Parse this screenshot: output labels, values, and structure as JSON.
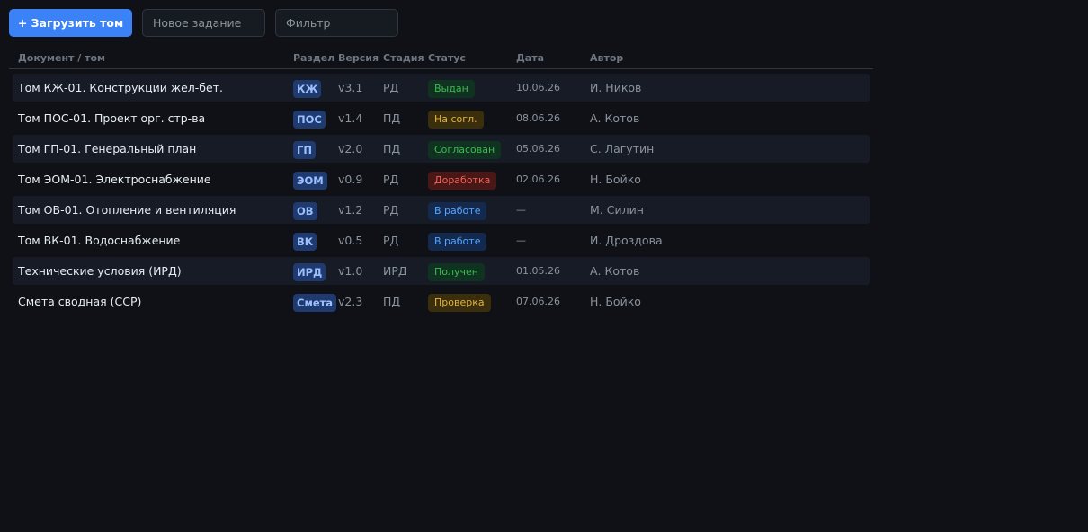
{
  "toolbar": {
    "upload_label": "+ Загрузить том",
    "task_placeholder": "Новое задание",
    "filter_placeholder": "Фильтр"
  },
  "table": {
    "headers": {
      "doc": "Документ / том",
      "section": "Раздел",
      "version": "Версия",
      "stage": "Стадия",
      "status": "Статус",
      "date": "Дата",
      "author": "Автор"
    },
    "rows": [
      {
        "doc": "Том КЖ-01. Конструкции жел-бет.",
        "section": "КЖ",
        "version": "v3.1",
        "stage": "РД",
        "status": "Выдан",
        "status_kind": "green",
        "date": "10.06.26",
        "author": "И. Ников"
      },
      {
        "doc": "Том ПОС-01. Проект орг. стр-ва",
        "section": "ПОС",
        "version": "v1.4",
        "stage": "ПД",
        "status": "На согл.",
        "status_kind": "yellow",
        "date": "08.06.26",
        "author": "А. Котов"
      },
      {
        "doc": "Том ГП-01. Генеральный план",
        "section": "ГП",
        "version": "v2.0",
        "stage": "ПД",
        "status": "Согласован",
        "status_kind": "green",
        "date": "05.06.26",
        "author": "С. Лагутин"
      },
      {
        "doc": "Том ЭОМ-01. Электроснабжение",
        "section": "ЭОМ",
        "version": "v0.9",
        "stage": "РД",
        "status": "Доработка",
        "status_kind": "red",
        "date": "02.06.26",
        "author": "Н. Бойко"
      },
      {
        "doc": "Том ОВ-01. Отопление и вентиляция",
        "section": "ОВ",
        "version": "v1.2",
        "stage": "РД",
        "status": "В работе",
        "status_kind": "blue",
        "date": "—",
        "author": "М. Силин"
      },
      {
        "doc": "Том ВК-01. Водоснабжение",
        "section": "ВК",
        "version": "v0.5",
        "stage": "РД",
        "status": "В работе",
        "status_kind": "blue",
        "date": "—",
        "author": "И. Дроздова"
      },
      {
        "doc": "Технические условия (ИРД)",
        "section": "ИРД",
        "version": "v1.0",
        "stage": "ИРД",
        "status": "Получен",
        "status_kind": "green",
        "date": "01.05.26",
        "author": "А. Котов"
      },
      {
        "doc": "Смета сводная (ССР)",
        "section": "Смета",
        "version": "v2.3",
        "stage": "ПД",
        "status": "Проверка",
        "status_kind": "yellow",
        "date": "07.06.26",
        "author": "Н. Бойко"
      }
    ]
  },
  "status_colors": {
    "green": {
      "bg": "#0f3320",
      "fg": "#3fb950"
    },
    "yellow": {
      "bg": "#3a2e0c",
      "fg": "#e3b341"
    },
    "red": {
      "bg": "#4a1717",
      "fg": "#f0625a"
    },
    "blue": {
      "bg": "#13294d",
      "fg": "#58a6ff"
    }
  },
  "accent_color": "#3b82f6"
}
